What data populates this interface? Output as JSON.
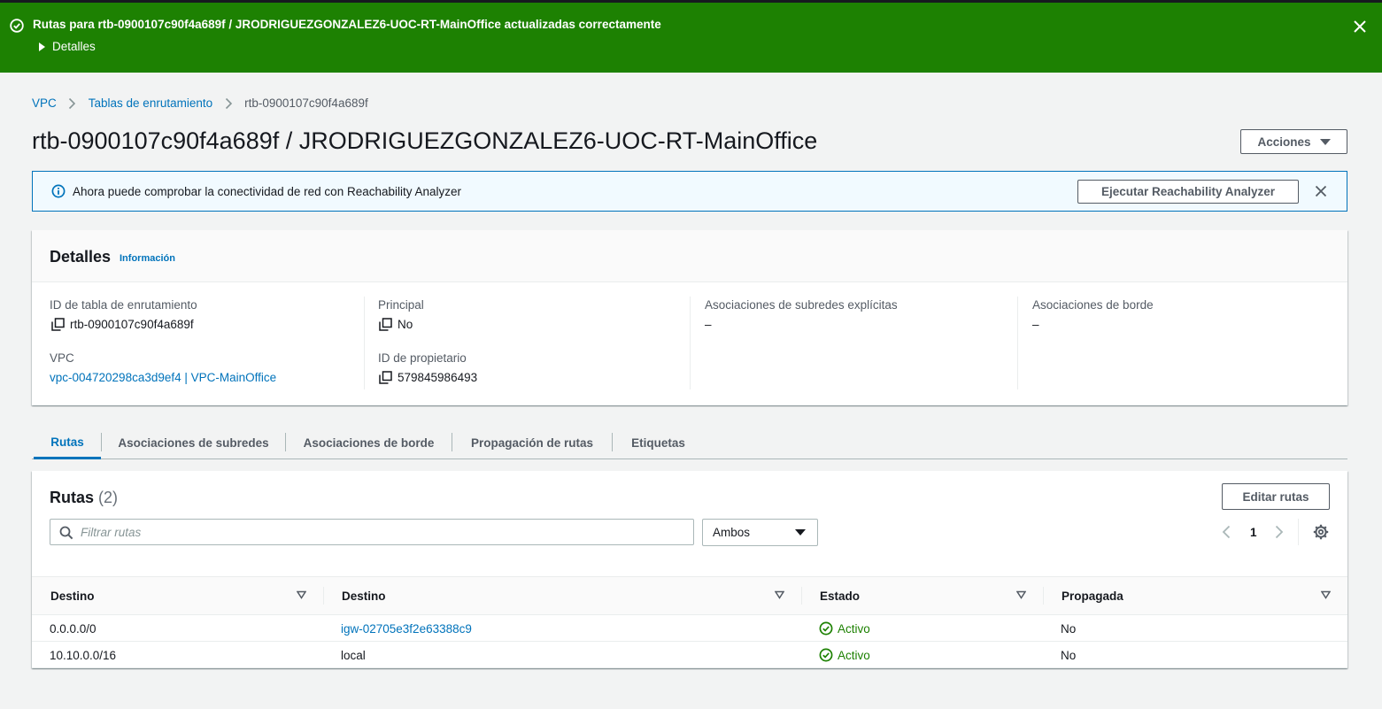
{
  "flash": {
    "message": "Rutas para rtb-0900107c90f4a689f / JRODRIGUEZGONZALEZ6-UOC-RT-MainOffice actualizadas correctamente",
    "details_label": "Detalles",
    "color": "#1d8102"
  },
  "breadcrumb": {
    "items": [
      "VPC",
      "Tablas de enrutamiento"
    ],
    "current": "rtb-0900107c90f4a689f"
  },
  "page": {
    "title": "rtb-0900107c90f4a689f / JRODRIGUEZGONZALEZ6-UOC-RT-MainOffice",
    "actions_label": "Acciones"
  },
  "info_banner": {
    "text": "Ahora puede comprobar la conectividad de red con Reachability Analyzer",
    "button_label": "Ejecutar Reachability Analyzer"
  },
  "details": {
    "title": "Detalles",
    "info_link": "Información",
    "fields": {
      "route_table_id": {
        "label": "ID de tabla de enrutamiento",
        "value": "rtb-0900107c90f4a689f"
      },
      "main": {
        "label": "Principal",
        "value": "No"
      },
      "subnet_assoc": {
        "label": "Asociaciones de subredes explícitas",
        "value": "–"
      },
      "edge_assoc": {
        "label": "Asociaciones de borde",
        "value": "–"
      },
      "vpc": {
        "label": "VPC",
        "value": "vpc-004720298ca3d9ef4 | VPC-MainOffice"
      },
      "owner_id": {
        "label": "ID de propietario",
        "value": "579845986493"
      }
    }
  },
  "tabs": [
    "Rutas",
    "Asociaciones de subredes",
    "Asociaciones de borde",
    "Propagación de rutas",
    "Etiquetas"
  ],
  "routes": {
    "title": "Rutas",
    "count": "(2)",
    "edit_label": "Editar rutas",
    "search_placeholder": "Filtrar rutas",
    "filter_selected": "Ambos",
    "page": "1",
    "columns": [
      "Destino",
      "Destino",
      "Estado",
      "Propagada"
    ],
    "rows": [
      {
        "destination": "0.0.0.0/0",
        "target": "igw-02705e3f2e63388c9",
        "target_is_link": true,
        "status": "Activo",
        "propagated": "No"
      },
      {
        "destination": "10.10.0.0/16",
        "target": "local",
        "target_is_link": false,
        "status": "Activo",
        "propagated": "No"
      }
    ]
  },
  "colors": {
    "link": "#0073bb",
    "success": "#1d8102",
    "text": "#16191f",
    "secondary_text": "#545b64",
    "background": "#f2f3f3"
  },
  "icons": [
    "success-circle-icon",
    "caret-right-icon",
    "close-icon",
    "chevron-right-icon",
    "caret-down-icon",
    "info-circle-icon",
    "copy-icon",
    "search-icon",
    "chevron-left-icon",
    "gear-icon",
    "sort-icon"
  ]
}
